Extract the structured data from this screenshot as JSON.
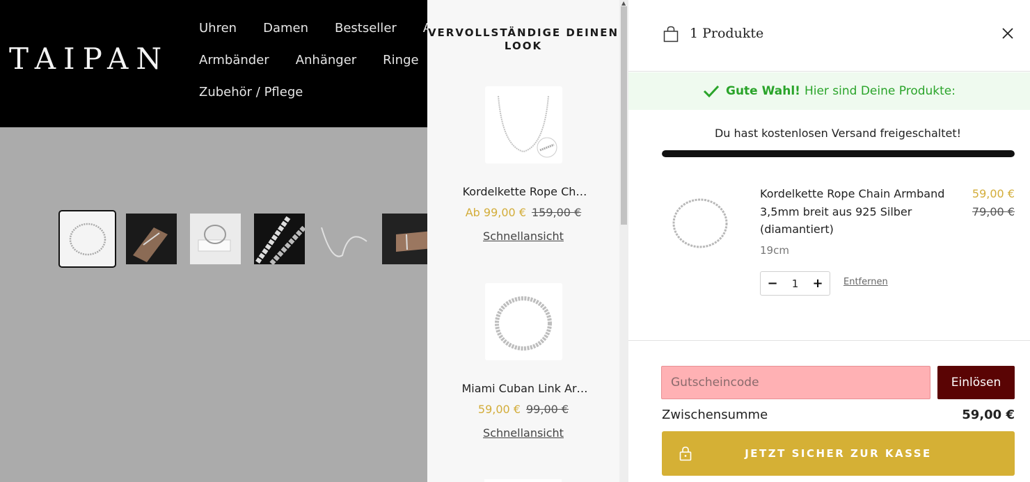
{
  "site": {
    "logo": "TAIPAN",
    "nav": [
      [
        "Uhren",
        "Damen",
        "Bestseller",
        "Ak"
      ],
      [
        "Armbänder",
        "Anhänger",
        "Ringe"
      ],
      [
        "Zubehör / Pflege"
      ]
    ]
  },
  "gallery": {
    "thumbnails": [
      "bracelet-ring",
      "wrist-photo",
      "gift-box",
      "chain-closeup",
      "loose-chain",
      "arm-photo"
    ]
  },
  "upsell": {
    "title": "VERVOLLSTÄNDIGE DEINEN LOOK",
    "items": [
      {
        "name": "Kordelkette Rope Ch…",
        "price": "Ab 99,00 €",
        "old_price": "159,00 €",
        "link": "Schnellansicht"
      },
      {
        "name": "Miami Cuban Link Ar…",
        "price": "59,00 €",
        "old_price": "99,00 €",
        "link": "Schnellansicht"
      }
    ]
  },
  "cart": {
    "count_label": "1 Produkte",
    "success_strong": "Gute Wahl!",
    "success_text": "Hier sind Deine Produkte:",
    "shipping_text": "Du hast kostenlosen Versand freigeschaltet!",
    "shipping_progress": 1.0,
    "item": {
      "name": "Kordelkette Rope Chain Armband 3,5mm breit aus 925 Silber (diamantiert)",
      "variant": "19cm",
      "price": "59,00 €",
      "old_price": "79,00 €",
      "quantity": "1",
      "remove": "Entfernen"
    },
    "coupon_placeholder": "Gutscheincode",
    "redeem_label": "Einlösen",
    "subtotal_label": "Zwischensumme",
    "subtotal_value": "59,00 €",
    "checkout_label": "JETZT SICHER ZUR KASSE"
  },
  "colors": {
    "accent_gold": "#d5b035",
    "success_green": "#2aa42a",
    "redeem_button": "#5a0404",
    "coupon_error_bg": "#ffb1b4"
  }
}
